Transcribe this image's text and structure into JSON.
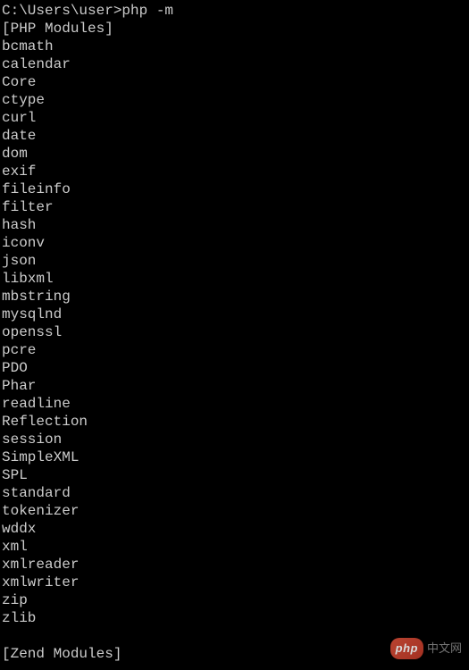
{
  "prompt": "C:\\Users\\user>",
  "command": "php -m",
  "section_php": "[PHP Modules]",
  "modules": [
    "bcmath",
    "calendar",
    "Core",
    "ctype",
    "curl",
    "date",
    "dom",
    "exif",
    "fileinfo",
    "filter",
    "hash",
    "iconv",
    "json",
    "libxml",
    "mbstring",
    "mysqlnd",
    "openssl",
    "pcre",
    "PDO",
    "Phar",
    "readline",
    "Reflection",
    "session",
    "SimpleXML",
    "SPL",
    "standard",
    "tokenizer",
    "wddx",
    "xml",
    "xmlreader",
    "xmlwriter",
    "zip",
    "zlib"
  ],
  "section_zend": "[Zend Modules]",
  "watermark": {
    "logo": "php",
    "text": "中文网"
  }
}
